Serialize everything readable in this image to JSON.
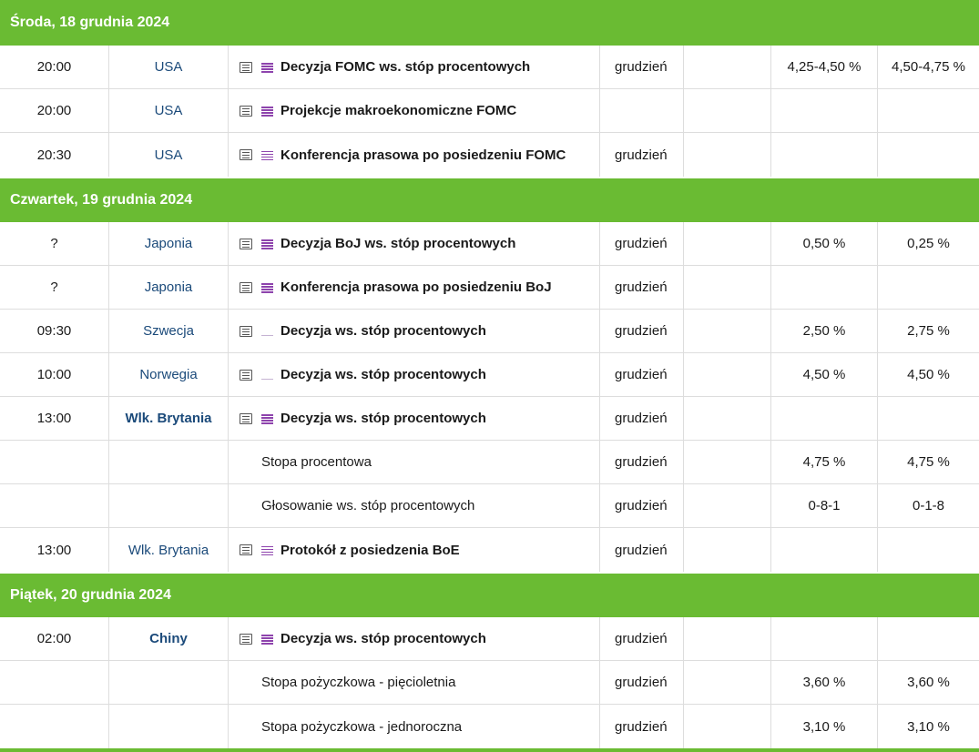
{
  "days": [
    {
      "header": "Środa, 18 grudnia 2024",
      "rows": [
        {
          "time": "20:00",
          "country": "USA",
          "country_bold": false,
          "icons": true,
          "importance": "high",
          "event": "Decyzja FOMC ws. stóp procentowych",
          "sub": false,
          "period": "grudzień",
          "previous": "4,25-4,50 %",
          "forecast": "4,50-4,75 %"
        },
        {
          "time": "20:00",
          "country": "USA",
          "country_bold": false,
          "icons": true,
          "importance": "high",
          "event": "Projekcje makroekonomiczne FOMC",
          "sub": false,
          "period": "",
          "previous": "",
          "forecast": ""
        },
        {
          "time": "20:30",
          "country": "USA",
          "country_bold": false,
          "icons": true,
          "importance": "high",
          "event": "Konferencja prasowa po posiedzeniu FOMC",
          "sub": false,
          "period": "grudzień",
          "previous": "",
          "forecast": ""
        }
      ]
    },
    {
      "header": "Czwartek, 19 grudnia 2024",
      "rows": [
        {
          "time": "?",
          "country": "Japonia",
          "country_bold": false,
          "icons": true,
          "importance": "high",
          "event": "Decyzja BoJ ws. stóp procentowych",
          "sub": false,
          "period": "grudzień",
          "previous": "0,50 %",
          "forecast": "0,25 %"
        },
        {
          "time": "?",
          "country": "Japonia",
          "country_bold": false,
          "icons": true,
          "importance": "high",
          "event": "Konferencja prasowa po posiedzeniu BoJ",
          "sub": false,
          "period": "grudzień",
          "previous": "",
          "forecast": ""
        },
        {
          "time": "09:30",
          "country": "Szwecja",
          "country_bold": false,
          "icons": true,
          "importance": "low",
          "event": "Decyzja ws. stóp procentowych",
          "sub": false,
          "period": "grudzień",
          "previous": "2,50 %",
          "forecast": "2,75 %"
        },
        {
          "time": "10:00",
          "country": "Norwegia",
          "country_bold": false,
          "icons": true,
          "importance": "low",
          "event": "Decyzja ws. stóp procentowych",
          "sub": false,
          "period": "grudzień",
          "previous": "4,50 %",
          "forecast": "4,50 %"
        },
        {
          "time": "13:00",
          "country": "Wlk. Brytania",
          "country_bold": true,
          "icons": true,
          "importance": "high",
          "event": "Decyzja ws. stóp procentowych",
          "sub": false,
          "period": "grudzień",
          "previous": "",
          "forecast": ""
        },
        {
          "time": "",
          "country": "",
          "country_bold": false,
          "icons": false,
          "importance": "",
          "event": "Stopa procentowa",
          "sub": true,
          "period": "grudzień",
          "previous": "4,75 %",
          "forecast": "4,75 %"
        },
        {
          "time": "",
          "country": "",
          "country_bold": false,
          "icons": false,
          "importance": "",
          "event": "Głosowanie ws. stóp procentowych",
          "sub": true,
          "period": "grudzień",
          "previous": "0-8-1",
          "forecast": "0-1-8"
        },
        {
          "time": "13:00",
          "country": "Wlk. Brytania",
          "country_bold": false,
          "icons": true,
          "importance": "high",
          "event": "Protokół z posiedzenia BoE",
          "sub": false,
          "period": "grudzień",
          "previous": "",
          "forecast": ""
        }
      ]
    },
    {
      "header": "Piątek, 20 grudnia 2024",
      "rows": [
        {
          "time": "02:00",
          "country": "Chiny",
          "country_bold": true,
          "icons": true,
          "importance": "high",
          "event": "Decyzja ws. stóp procentowych",
          "sub": false,
          "period": "grudzień",
          "previous": "",
          "forecast": ""
        },
        {
          "time": "",
          "country": "",
          "country_bold": false,
          "icons": false,
          "importance": "",
          "event": "Stopa pożyczkowa - pięcioletnia",
          "sub": true,
          "period": "grudzień",
          "previous": "3,60 %",
          "forecast": "3,60 %"
        },
        {
          "time": "",
          "country": "",
          "country_bold": false,
          "icons": false,
          "importance": "",
          "event": "Stopa pożyczkowa - jednoroczna",
          "sub": true,
          "period": "grudzień",
          "previous": "3,10 %",
          "forecast": "3,10 %"
        }
      ]
    }
  ],
  "icon_names": {
    "details": "list-details-icon",
    "importance": "importance-bars-icon"
  },
  "colors": {
    "header_green": "#6abb33",
    "country_blue": "#1b4a7a",
    "importance_purple": "#8e44ad"
  }
}
